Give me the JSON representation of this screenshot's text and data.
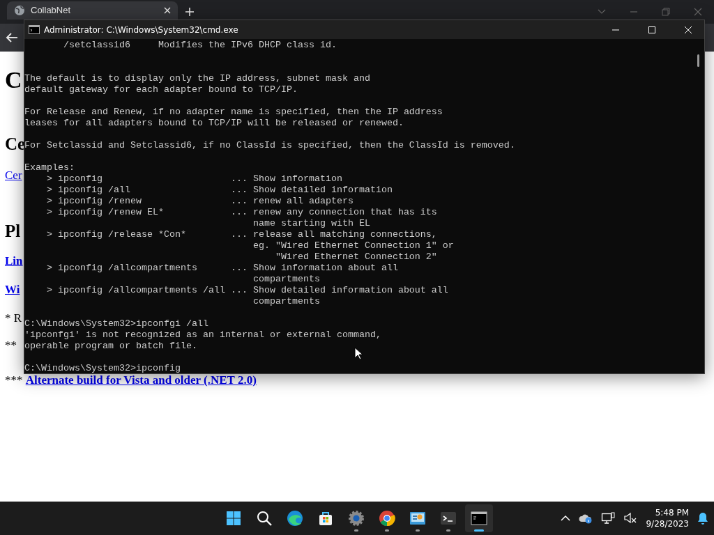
{
  "browser": {
    "tab": {
      "title": "CollabNet"
    }
  },
  "page": {
    "title": "C",
    "section_headings": [
      "Ce",
      "Pl"
    ],
    "section_link": "Cer",
    "downloads": [
      "Lin",
      "Wi"
    ],
    "notes": [
      "* R",
      "**"
    ],
    "footer_note": {
      "mark": "***",
      "link": "Alternate build for Vista and older (.NET 2.0)"
    }
  },
  "console": {
    "title": "Administrator: C:\\Windows\\System32\\cmd.exe",
    "blocks": [
      {
        "lines": [
          "       /setclassid6     Modifies the IPv6 DHCP class id."
        ]
      },
      {
        "lines": [
          "The default is to display only the IP address, subnet mask and",
          "default gateway for each adapter bound to TCP/IP."
        ]
      },
      {
        "lines": [
          "For Release and Renew, if no adapter name is specified, then the IP address",
          "leases for all adapters bound to TCP/IP will be released or renewed."
        ]
      },
      {
        "lines": [
          "For Setclassid and Setclassid6, if no ClassId is specified, then the ClassId is removed."
        ]
      },
      {
        "lines": [
          "Examples:",
          "    > ipconfig                       ... Show information",
          "    > ipconfig /all                  ... Show detailed information",
          "    > ipconfig /renew                ... renew all adapters",
          "    > ipconfig /renew EL*            ... renew any connection that has its",
          "                                         name starting with EL",
          "    > ipconfig /release *Con*        ... release all matching connections,",
          "                                         eg. \"Wired Ethernet Connection 1\" or",
          "                                             \"Wired Ethernet Connection 2\"",
          "    > ipconfig /allcompartments      ... Show information about all",
          "                                         compartments",
          "    > ipconfig /allcompartments /all ... Show detailed information about all",
          "                                         compartments"
        ]
      },
      {
        "lines": [
          "C:\\Windows\\System32>ipconfgi /all",
          "'ipconfgi' is not recognized as an internal or external command,",
          "operable program or batch file."
        ]
      },
      {
        "lines": [
          "C:\\Windows\\System32>ipconfig"
        ]
      }
    ]
  },
  "taskbar": {
    "apps": [
      {
        "kind": "start",
        "running": false,
        "active": false
      },
      {
        "kind": "search",
        "running": false,
        "active": false
      },
      {
        "kind": "edge",
        "running": false,
        "active": false
      },
      {
        "kind": "store",
        "running": false,
        "active": false
      },
      {
        "kind": "settings",
        "running": true,
        "active": false
      },
      {
        "kind": "chrome",
        "running": true,
        "active": false
      },
      {
        "kind": "control",
        "running": true,
        "active": false
      },
      {
        "kind": "terminal",
        "running": true,
        "active": false
      },
      {
        "kind": "cmd",
        "running": true,
        "active": true
      }
    ],
    "time": "5:48 PM",
    "date": "9/28/2023"
  }
}
